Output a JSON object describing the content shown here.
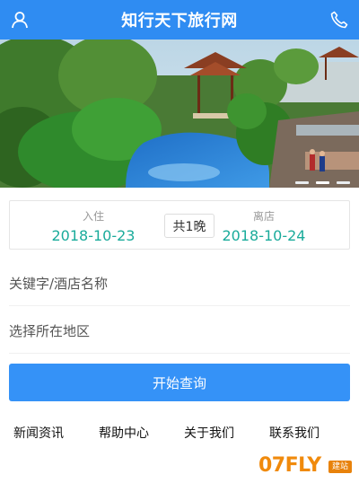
{
  "header": {
    "title": "知行天下旅行网",
    "left_icon": "user-icon",
    "right_icon": "phone-icon"
  },
  "banner": {
    "slides_total": 3,
    "active_slide": 2
  },
  "booking": {
    "checkin_label": "入住",
    "checkin_date": "2018-10-23",
    "nights_label": "共1晚",
    "checkout_label": "离店",
    "checkout_date": "2018-10-24"
  },
  "search": {
    "keyword_placeholder": "关键字/酒店名称",
    "region_placeholder": "选择所在地区",
    "button_label": "开始查询"
  },
  "footer_links": [
    "新闻资讯",
    "帮助中心",
    "关于我们",
    "联系我们"
  ],
  "watermark": {
    "text": "07FLY",
    "tag": "建站"
  },
  "colors": {
    "header_bg": "#2f8cf2",
    "date_text": "#1aab9b",
    "button_bg": "#3592f7"
  }
}
